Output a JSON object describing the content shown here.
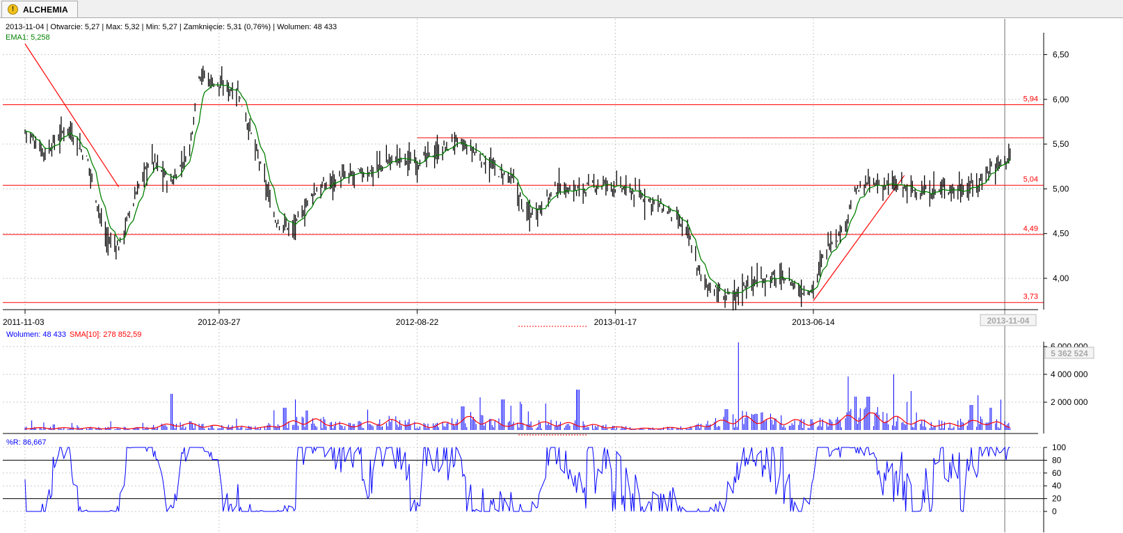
{
  "tab": {
    "title": "ALCHEMIA",
    "icon": "warning-icon"
  },
  "colors": {
    "price": "#000000",
    "ema": "#008000",
    "volume": "#0000ff",
    "sma": "#ff0000",
    "hline": "#ff0000",
    "williams": "#0000ff",
    "grid": "#c8c8c8",
    "cursor": "#a0a0a0"
  },
  "chart_data": [
    {
      "type": "ohlc",
      "info": "2013-11-04 | Otwarcie: 5,27 | Max: 5,32 | Min: 5,27 | Zamknięcie: 5,31 (0,76%)  | Wolumen: 48 433",
      "ema_label": "EMA1: 5,258",
      "x_ticks": [
        "2011-11-03",
        "2012-03-27",
        "2012-08-22",
        "2013-01-17",
        "2013-06-14"
      ],
      "cursor_label": "2013-11-04",
      "y_ticks": [
        "4,00",
        "4,50",
        "5,00",
        "5,50",
        "6,00",
        "6,50"
      ],
      "ylim": [
        3.65,
        6.9
      ],
      "hlines": [
        5.94,
        5.04,
        4.49,
        3.73
      ],
      "hline_labels": [
        "5,94",
        "5,04",
        "4,49",
        "3,73"
      ],
      "resistance": 5.57,
      "trendlines": [
        {
          "from": [
            "2011-11-03",
            6.62
          ],
          "to": [
            "2012-01-12",
            5.02
          ]
        },
        {
          "from": [
            "2013-06-14",
            3.75
          ],
          "to": [
            "2013-08-21",
            5.15
          ]
        }
      ],
      "closes": [
        {
          "x": "2011-11-03",
          "c": 5.65
        },
        {
          "x": "2011-11-18",
          "c": 5.4
        },
        {
          "x": "2011-12-05",
          "c": 5.7
        },
        {
          "x": "2011-12-20",
          "c": 5.3
        },
        {
          "x": "2012-01-02",
          "c": 4.45
        },
        {
          "x": "2012-01-12",
          "c": 4.35
        },
        {
          "x": "2012-01-25",
          "c": 4.95
        },
        {
          "x": "2012-02-05",
          "c": 5.35
        },
        {
          "x": "2012-02-20",
          "c": 5.05
        },
        {
          "x": "2012-03-05",
          "c": 5.45
        },
        {
          "x": "2012-03-12",
          "c": 6.3
        },
        {
          "x": "2012-03-27",
          "c": 6.15
        },
        {
          "x": "2012-04-10",
          "c": 6.1
        },
        {
          "x": "2012-04-24",
          "c": 5.4
        },
        {
          "x": "2012-05-08",
          "c": 4.65
        },
        {
          "x": "2012-05-22",
          "c": 4.55
        },
        {
          "x": "2012-06-05",
          "c": 4.95
        },
        {
          "x": "2012-06-20",
          "c": 5.1
        },
        {
          "x": "2012-07-05",
          "c": 5.15
        },
        {
          "x": "2012-07-20",
          "c": 5.2
        },
        {
          "x": "2012-08-05",
          "c": 5.35
        },
        {
          "x": "2012-08-22",
          "c": 5.3
        },
        {
          "x": "2012-09-05",
          "c": 5.4
        },
        {
          "x": "2012-09-20",
          "c": 5.52
        },
        {
          "x": "2012-10-05",
          "c": 5.4
        },
        {
          "x": "2012-10-20",
          "c": 5.2
        },
        {
          "x": "2012-11-01",
          "c": 5.1
        },
        {
          "x": "2012-11-12",
          "c": 4.7
        },
        {
          "x": "2012-11-22",
          "c": 4.8
        },
        {
          "x": "2012-12-05",
          "c": 5.02
        },
        {
          "x": "2012-12-20",
          "c": 4.98
        },
        {
          "x": "2013-01-05",
          "c": 5.05
        },
        {
          "x": "2013-01-17",
          "c": 5.03
        },
        {
          "x": "2013-02-01",
          "c": 4.95
        },
        {
          "x": "2013-02-15",
          "c": 4.85
        },
        {
          "x": "2013-03-01",
          "c": 4.7
        },
        {
          "x": "2013-03-12",
          "c": 4.5
        },
        {
          "x": "2013-03-22",
          "c": 4.0
        },
        {
          "x": "2013-04-05",
          "c": 3.82
        },
        {
          "x": "2013-04-15",
          "c": 3.78
        },
        {
          "x": "2013-04-25",
          "c": 3.95
        },
        {
          "x": "2013-05-10",
          "c": 4.0
        },
        {
          "x": "2013-05-25",
          "c": 4.0
        },
        {
          "x": "2013-06-05",
          "c": 3.85
        },
        {
          "x": "2013-06-14",
          "c": 3.9
        },
        {
          "x": "2013-06-25",
          "c": 4.4
        },
        {
          "x": "2013-07-05",
          "c": 4.5
        },
        {
          "x": "2013-07-15",
          "c": 4.95
        },
        {
          "x": "2013-07-25",
          "c": 5.05
        },
        {
          "x": "2013-08-05",
          "c": 5.05
        },
        {
          "x": "2013-08-20",
          "c": 5.02
        },
        {
          "x": "2013-09-05",
          "c": 4.95
        },
        {
          "x": "2013-09-20",
          "c": 5.0
        },
        {
          "x": "2013-10-05",
          "c": 5.0
        },
        {
          "x": "2013-10-15",
          "c": 5.05
        },
        {
          "x": "2013-10-25",
          "c": 5.25
        },
        {
          "x": "2013-11-04",
          "c": 5.31
        },
        {
          "x": "2013-11-10",
          "c": 5.45
        }
      ]
    },
    {
      "type": "bar",
      "label_volume": "Wolumen: 48 433",
      "label_sma": "SMA[10]: 278 852,59",
      "y_ticks": [
        "2 000 000",
        "4 000 000",
        "6 000 000"
      ],
      "ylim": [
        0,
        6500000
      ],
      "cursor_value": "5 362 524",
      "spikes": [
        {
          "x": "2011-11-25",
          "v": 400000
        },
        {
          "x": "2012-02-20",
          "v": 2600000
        },
        {
          "x": "2012-04-20",
          "v": 250000
        },
        {
          "x": "2012-05-15",
          "v": 1600000
        },
        {
          "x": "2012-06-01",
          "v": 1400000
        },
        {
          "x": "2012-09-25",
          "v": 1700000
        },
        {
          "x": "2012-10-25",
          "v": 2200000
        },
        {
          "x": "2012-11-25",
          "v": 1900000
        },
        {
          "x": "2012-12-20",
          "v": 2900000
        },
        {
          "x": "2013-04-20",
          "v": 6300000
        },
        {
          "x": "2013-04-10",
          "v": 1500000
        },
        {
          "x": "2013-07-15",
          "v": 2400000
        },
        {
          "x": "2013-07-25",
          "v": 2400000
        },
        {
          "x": "2013-08-25",
          "v": 2800000
        },
        {
          "x": "2013-10-10",
          "v": 1800000
        },
        {
          "x": "2013-10-25",
          "v": 1600000
        }
      ],
      "sma": [
        {
          "x": "2011-11-03",
          "v": 150000
        },
        {
          "x": "2012-02-01",
          "v": 150000
        },
        {
          "x": "2012-02-25",
          "v": 500000
        },
        {
          "x": "2012-04-01",
          "v": 250000
        },
        {
          "x": "2012-05-01",
          "v": 200000
        },
        {
          "x": "2012-06-01",
          "v": 800000
        },
        {
          "x": "2012-07-01",
          "v": 350000
        },
        {
          "x": "2012-08-01",
          "v": 700000
        },
        {
          "x": "2012-09-01",
          "v": 300000
        },
        {
          "x": "2012-10-01",
          "v": 900000
        },
        {
          "x": "2012-11-01",
          "v": 400000
        },
        {
          "x": "2012-12-01",
          "v": 550000
        },
        {
          "x": "2013-01-01",
          "v": 350000
        },
        {
          "x": "2013-02-01",
          "v": 100000
        },
        {
          "x": "2013-03-15",
          "v": 200000
        },
        {
          "x": "2013-04-20",
          "v": 900000
        },
        {
          "x": "2013-05-25",
          "v": 700000
        },
        {
          "x": "2013-06-25",
          "v": 550000
        },
        {
          "x": "2013-07-20",
          "v": 1200000
        },
        {
          "x": "2013-08-20",
          "v": 800000
        },
        {
          "x": "2013-09-20",
          "v": 400000
        },
        {
          "x": "2013-10-20",
          "v": 700000
        },
        {
          "x": "2013-11-10",
          "v": 280000
        }
      ]
    },
    {
      "type": "line",
      "label": "%R: 86,667",
      "y_ticks": [
        "0",
        "20",
        "40",
        "60",
        "80",
        "100"
      ],
      "ylim": [
        0,
        100
      ],
      "hlines": [
        20,
        80
      ]
    }
  ]
}
